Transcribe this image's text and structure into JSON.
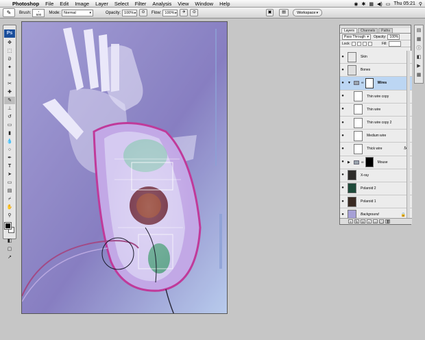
{
  "menubar": {
    "app_name": "Photoshop",
    "items": [
      "File",
      "Edit",
      "Image",
      "Layer",
      "Select",
      "Filter",
      "Analysis",
      "View",
      "Window",
      "Help"
    ],
    "clock": "Thu 05:21"
  },
  "options": {
    "brush_label": "Brush:",
    "brush_size": "500",
    "mode_label": "Mode:",
    "mode_value": "Normal",
    "opacity_label": "Opacity:",
    "opacity_value": "100%",
    "flow_label": "Flow:",
    "flow_value": "100%",
    "workspace_label": "Workspace"
  },
  "toolbox": {
    "logo": "Ps",
    "tools": [
      "move-icon",
      "marquee-icon",
      "lasso-icon",
      "magic-wand-icon",
      "crop-icon",
      "slice-icon",
      "healing-icon",
      "brush-icon",
      "stamp-icon",
      "history-brush-icon",
      "eraser-icon",
      "gradient-icon",
      "blur-icon",
      "dodge-icon",
      "pen-icon",
      "type-icon",
      "path-select-icon",
      "shape-icon",
      "notes-icon",
      "eyedropper-icon",
      "hand-icon",
      "zoom-icon"
    ]
  },
  "layers_panel": {
    "tabs": [
      "Layers",
      "Channels",
      "Paths"
    ],
    "blend_mode": "Pass Through",
    "opacity_label": "Opacity:",
    "opacity_value": "100%",
    "lock_label": "Lock:",
    "fill_label": "Fill:",
    "layers": [
      {
        "name": "Skin",
        "thumb": "#e8e8e8",
        "kind": "layer"
      },
      {
        "name": "Bones",
        "thumb": "#dedede",
        "kind": "layer"
      },
      {
        "name": "Wires",
        "thumb": "#ffffff",
        "kind": "group-open",
        "selected": true
      },
      {
        "name": "Thin wire copy",
        "thumb": "#ffffff",
        "kind": "child"
      },
      {
        "name": "Thin wire",
        "thumb": "#ffffff",
        "kind": "child"
      },
      {
        "name": "Thin wire copy 2",
        "thumb": "#ffffff",
        "kind": "child"
      },
      {
        "name": "Medium wire",
        "thumb": "#ffffff",
        "kind": "child"
      },
      {
        "name": "Thick wire",
        "thumb": "#ffffff",
        "kind": "child",
        "fx": "fx"
      },
      {
        "name": "Mouse",
        "thumb": "#ffffff",
        "kind": "group-closed"
      },
      {
        "name": "X-ray",
        "thumb": "#2e2c2a",
        "kind": "layer"
      },
      {
        "name": "Polaroid 2",
        "thumb": "#1e4a3a",
        "kind": "layer"
      },
      {
        "name": "Polaroid 1",
        "thumb": "#3a2a22",
        "kind": "layer"
      },
      {
        "name": "Background",
        "thumb": "#a6a0d6",
        "kind": "layer",
        "locked": true
      }
    ]
  },
  "colors": {
    "canvas_bg": "#8d84c4",
    "selection": "#bcd6f3",
    "foreground": "#000000",
    "background": "#ffffff"
  }
}
